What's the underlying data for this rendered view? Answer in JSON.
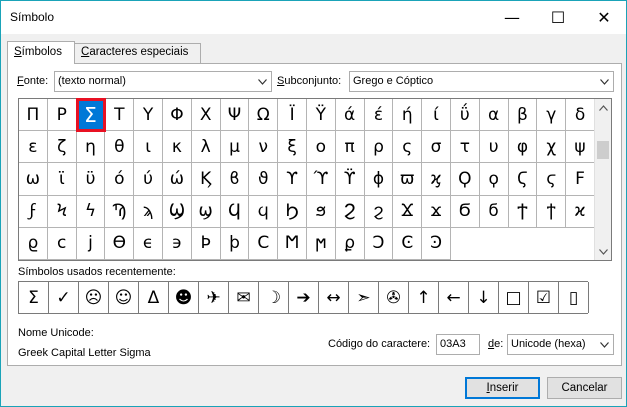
{
  "window": {
    "title": "Símbolo",
    "minimize_glyph": "—",
    "maximize_glyph": "☐",
    "close_glyph": "✕"
  },
  "tabs": [
    {
      "label_underlined": "S",
      "label_rest": "ímbolos"
    },
    {
      "label_underlined": "C",
      "label_rest": "aracteres especiais"
    }
  ],
  "font": {
    "label_underlined": "F",
    "label_rest": "onte:",
    "value": "(texto normal)"
  },
  "subset": {
    "label_underlined": "S",
    "label_rest": "ubconjunto:",
    "value": "Grego e Cóptico"
  },
  "symbols": [
    "Π",
    "Ρ",
    "Σ",
    "Τ",
    "Υ",
    "Φ",
    "Χ",
    "Ψ",
    "Ω",
    "Ϊ",
    "Ϋ",
    "ά",
    "έ",
    "ή",
    "ί",
    "ΰ",
    "α",
    "β",
    "γ",
    "δ",
    "ε",
    "ζ",
    "η",
    "θ",
    "ι",
    "κ",
    "λ",
    "μ",
    "ν",
    "ξ",
    "ο",
    "π",
    "ρ",
    "ς",
    "σ",
    "τ",
    "υ",
    "φ",
    "χ",
    "ψ",
    "ω",
    "ϊ",
    "ϋ",
    "ό",
    "ύ",
    "ώ",
    "Ϗ",
    "ϐ",
    "ϑ",
    "ϒ",
    "ϓ",
    "ϔ",
    "ϕ",
    "ϖ",
    "ϗ",
    "Ϙ",
    "ϙ",
    "Ϛ",
    "ϛ",
    "Ϝ",
    "ϝ",
    "Ϟ",
    "ϟ",
    "Ϡ",
    "ϡ",
    "Ϣ",
    "ϣ",
    "Ϥ",
    "ϥ",
    "Ϧ",
    "ϧ",
    "Ϩ",
    "ϩ",
    "Ϫ",
    "ϫ",
    "Ϭ",
    "ϭ",
    "Ϯ",
    "ϯ",
    "ϰ",
    "ϱ",
    "ϲ",
    "ϳ",
    "ϴ",
    "ϵ",
    "϶",
    "Ϸ",
    "ϸ",
    "Ϲ",
    "Ϻ",
    "ϻ",
    "ϼ",
    "Ͻ",
    "Ͼ",
    "Ͽ"
  ],
  "selected_index": 2,
  "recent": {
    "label": "Símbolos usados recentemente:",
    "symbols": [
      "Σ",
      "✓",
      "☹",
      "☺",
      "Δ",
      "☻",
      "✈",
      "✉",
      "☽",
      "➔",
      "↔",
      "➣",
      "✇",
      "↑",
      "←",
      "↓",
      "□",
      "☑",
      "▯"
    ]
  },
  "unicode_name": {
    "label": "Nome Unicode:",
    "value": "Greek Capital Letter Sigma"
  },
  "char_code": {
    "label_rest_before": "Código do caractere:",
    "value": "03A3"
  },
  "from": {
    "label_underlined": "d",
    "label_rest": "e:",
    "value": "Unicode (hexa)"
  },
  "buttons": {
    "insert_underlined": "I",
    "insert_rest": "nserir",
    "cancel": "Cancelar"
  }
}
